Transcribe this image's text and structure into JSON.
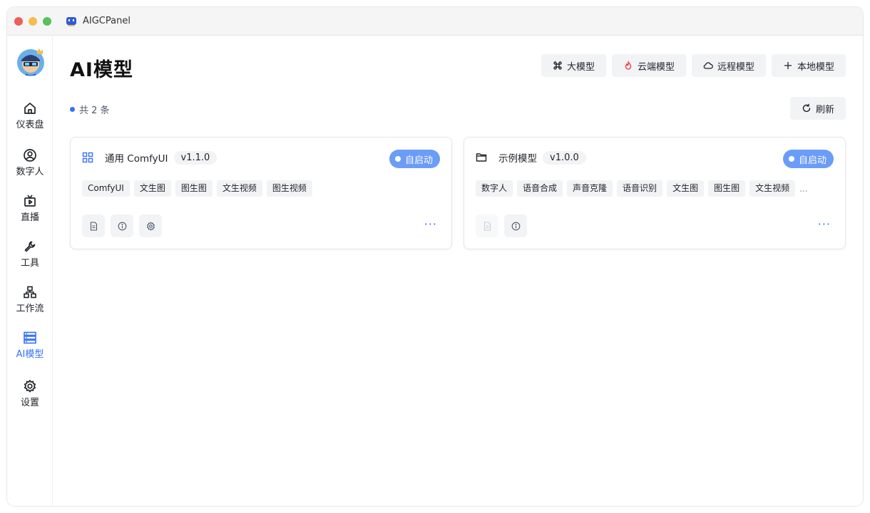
{
  "window": {
    "title": "AIGCPanel"
  },
  "sidebar": {
    "items": [
      {
        "label": "仪表盘",
        "icon": "home-icon"
      },
      {
        "label": "数字人",
        "icon": "user-circle-icon"
      },
      {
        "label": "直播",
        "icon": "tv-icon"
      },
      {
        "label": "工具",
        "icon": "wrench-icon"
      },
      {
        "label": "工作流",
        "icon": "workflow-icon"
      },
      {
        "label": "AI模型",
        "icon": "server-icon",
        "active": true
      },
      {
        "label": "设置",
        "icon": "gear-icon"
      }
    ]
  },
  "header": {
    "title": "AI模型",
    "actions": [
      {
        "label": "大模型",
        "icon": "command-icon"
      },
      {
        "label": "云端模型",
        "icon": "fire-icon"
      },
      {
        "label": "远程模型",
        "icon": "cloud-icon"
      },
      {
        "label": "本地模型",
        "icon": "plus-icon"
      }
    ]
  },
  "summary": {
    "count_text": "共 2 条"
  },
  "refresh": {
    "label": "刷新"
  },
  "cards": [
    {
      "name": "通用 ComfyUI",
      "version": "v1.1.0",
      "auto_label": "自启动",
      "tags": [
        "ComfyUI",
        "文生图",
        "图生图",
        "文生视频",
        "图生视频"
      ],
      "more": "···"
    },
    {
      "name": "示例模型",
      "version": "v1.0.0",
      "auto_label": "自启动",
      "tags": [
        "数字人",
        "语音合成",
        "声音克隆",
        "语音识别",
        "文生图",
        "图生图",
        "文生视频"
      ],
      "overflow": "...",
      "more": "···"
    }
  ],
  "colors": {
    "accent": "#3370ff",
    "auto_badge": "#6b9cf7",
    "fire": "#f53f3f"
  }
}
